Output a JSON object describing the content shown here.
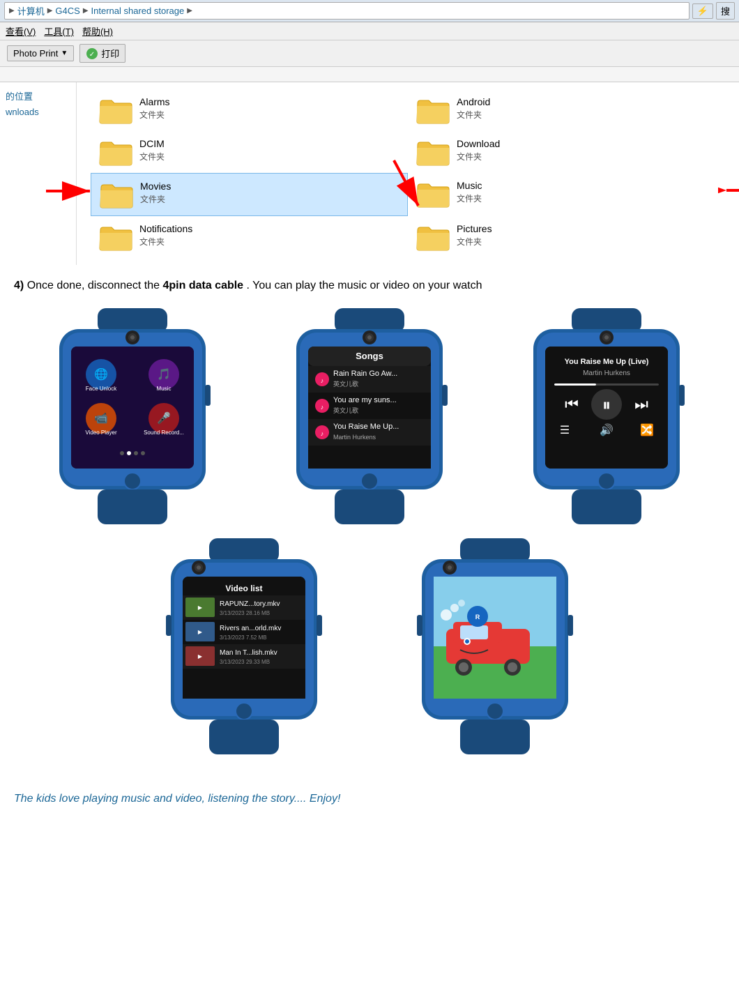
{
  "explorer": {
    "breadcrumbs": [
      "计算机",
      "G4CS",
      "Internal shared storage"
    ],
    "menu_items": [
      "查看(V)",
      "工具(T)",
      "帮助(H)"
    ],
    "toolbar": {
      "photo_print_label": "Photo Print",
      "print_label": "打印",
      "dropdown_symbol": "▼"
    },
    "sidebar": {
      "items": [
        "的位置",
        "wnloads"
      ]
    },
    "folders": [
      {
        "name": "Alarms",
        "type": "文件夹",
        "selected": false,
        "arrow": false
      },
      {
        "name": "Android",
        "type": "文件夹",
        "selected": false,
        "arrow": false
      },
      {
        "name": "DCIM",
        "type": "文件夹",
        "selected": false,
        "arrow": true,
        "arrow_dir": "down-right"
      },
      {
        "name": "Download",
        "type": "文件夹",
        "selected": false,
        "arrow": false
      },
      {
        "name": "Movies",
        "type": "文件夹",
        "selected": true,
        "arrow": true,
        "arrow_dir": "right"
      },
      {
        "name": "Music",
        "type": "文件夹",
        "selected": false,
        "arrow": true,
        "arrow_dir": "left"
      },
      {
        "name": "Notifications",
        "type": "文件夹",
        "selected": false,
        "arrow": false
      },
      {
        "name": "Pictures",
        "type": "文件夹",
        "selected": false,
        "arrow": false
      }
    ]
  },
  "step4": {
    "prefix": "4)",
    "text_before": " Once done, disconnect the ",
    "highlight": "4pin data cable",
    "text_after": ". You can play the music or video on your watch"
  },
  "watches": {
    "row1": [
      {
        "id": "watch-menu",
        "screen_title": "",
        "screen_items": [
          "Face Unlock",
          "Music",
          "Video Player",
          "Sound Record..."
        ],
        "colors": {
          "bg": "#1a1a2e",
          "accent1": "#e040fb",
          "accent2": "#00bcd4",
          "accent3": "#ff9800",
          "accent4": "#f44336"
        }
      },
      {
        "id": "watch-songs",
        "screen_title": "Songs",
        "songs": [
          {
            "title": "Rain Rain Go Aw...",
            "subtitle": "英文儿歌"
          },
          {
            "title": "You are my suns...",
            "subtitle": "英文儿歌"
          },
          {
            "title": "You Raise Me Up...",
            "subtitle": "Martin Hurkens"
          }
        ]
      },
      {
        "id": "watch-player",
        "screen_title": "You Raise Me Up (Live)",
        "screen_subtitle": "Martin Hurkens",
        "controls": [
          "prev",
          "pause",
          "next",
          "list",
          "volume",
          "repeat"
        ]
      }
    ],
    "row2": [
      {
        "id": "watch-video",
        "screen_title": "Video list",
        "videos": [
          {
            "title": "RAPUNZ...tory.mkv",
            "date": "3/13/2023 28.16 MB"
          },
          {
            "title": "Rivers an...orld.mkv",
            "date": "3/13/2023 7.52 MB"
          },
          {
            "title": "Man In T...lish.mkv",
            "date": "3/13/2023 29.33 MB"
          }
        ]
      },
      {
        "id": "watch-cartoon",
        "screen_content": "cartoon-train"
      }
    ]
  },
  "bottom_text": "The kids love playing music and video, listening the story.... Enjoy!"
}
